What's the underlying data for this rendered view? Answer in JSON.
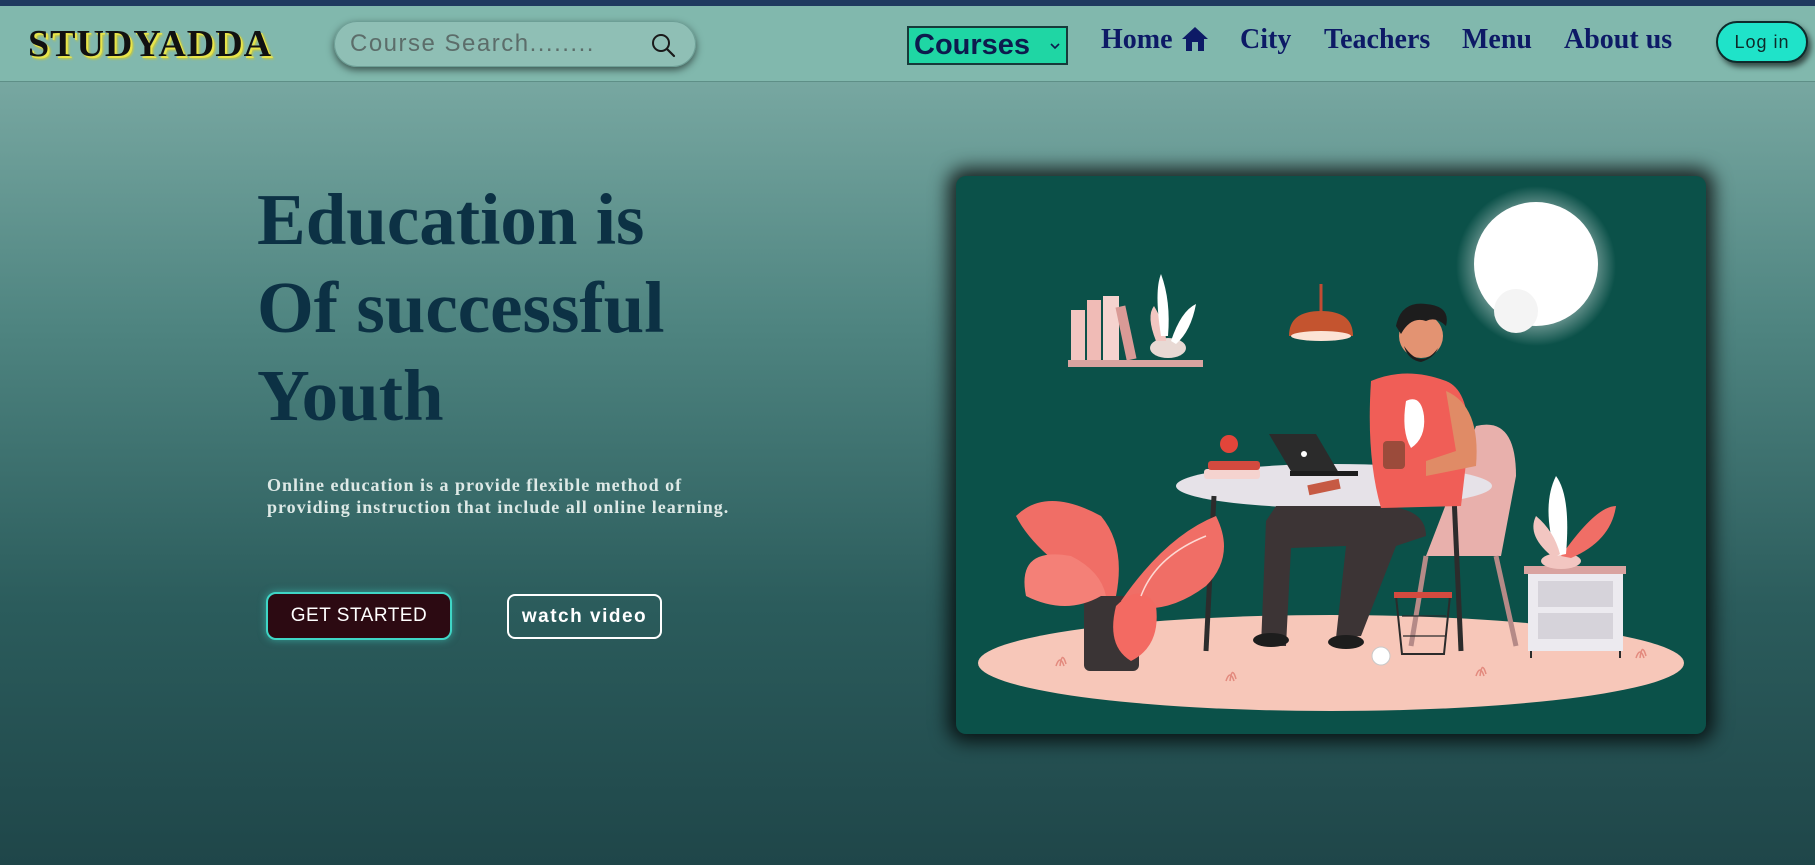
{
  "header": {
    "logo": "STUDYADDA",
    "search": {
      "placeholder": "Course Search........",
      "icon": "search-icon"
    },
    "courses_dropdown": {
      "label": "Courses",
      "icon": "chevron-down-icon"
    },
    "nav": [
      {
        "label": "Home",
        "icon": "home-icon"
      },
      {
        "label": "City"
      },
      {
        "label": "Teachers"
      },
      {
        "label": "Menu"
      },
      {
        "label": "About us"
      }
    ],
    "login_label": "Log in"
  },
  "hero": {
    "headline": [
      "Education is",
      "Of successful",
      "Youth"
    ],
    "description": "Online education is a provide flexible method of providing instruction that include all online learning.",
    "primary_button": "GET STARTED",
    "secondary_button": "watch video",
    "illustration": "person-studying-with-laptop-illustration"
  },
  "colors": {
    "navbar": "#81b8ad",
    "accent": "#1fd6a4",
    "login_button": "#1fe3c9",
    "headline": "#0c3144",
    "nav_text": "#0d1a66",
    "illustration_bg": "#0b5149"
  }
}
